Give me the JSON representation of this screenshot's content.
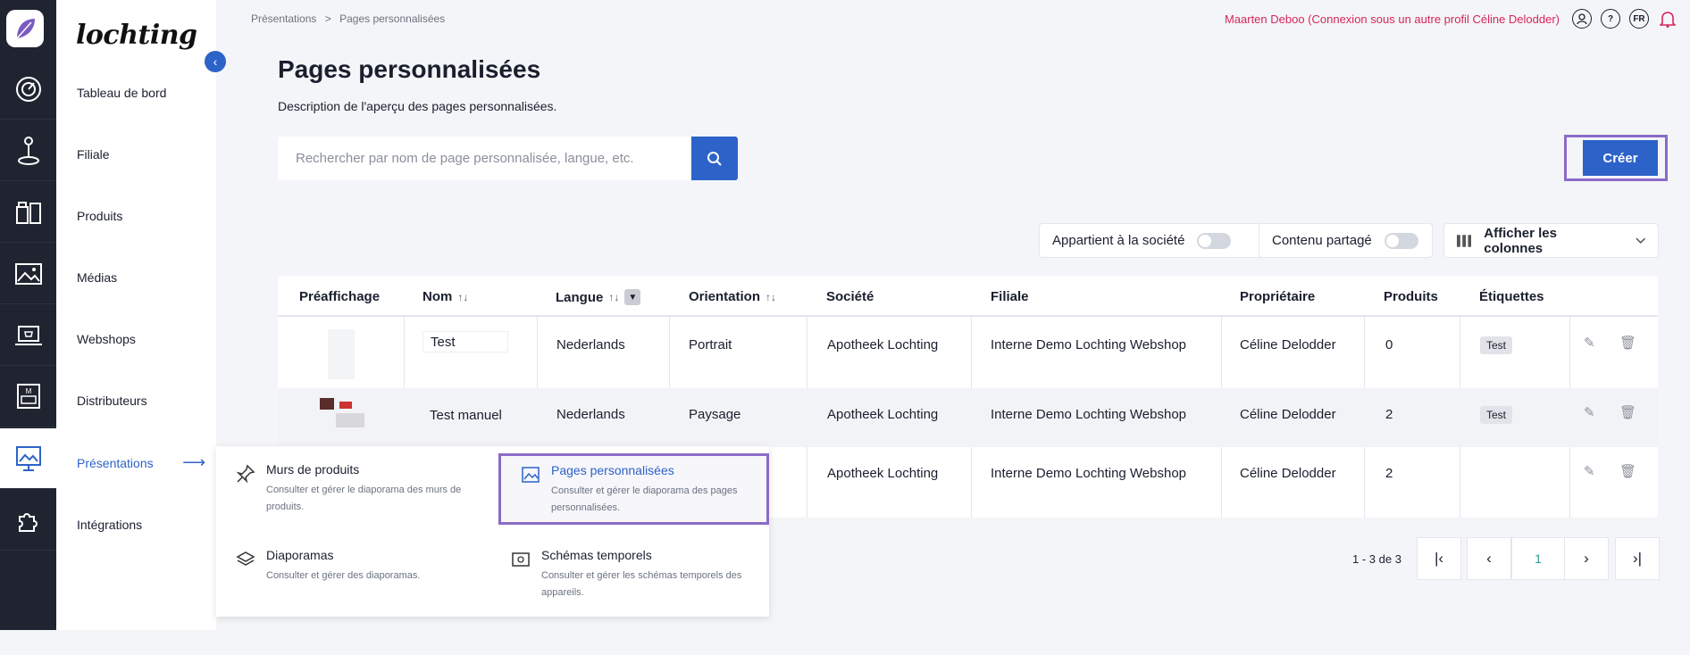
{
  "brand": "lochting",
  "breadcrumbs": [
    "Présentations",
    "Pages personnalisées"
  ],
  "breadcrumb_sep": ">",
  "user": {
    "label": "Maarten Deboo (Connexion sous un autre profil Céline Delodder)",
    "lang": "FR",
    "help": "?"
  },
  "sidebar": {
    "items": [
      {
        "label": "Tableau de bord"
      },
      {
        "label": "Filiale"
      },
      {
        "label": "Produits"
      },
      {
        "label": "Médias"
      },
      {
        "label": "Webshops"
      },
      {
        "label": "Distributeurs"
      },
      {
        "label": "Présentations"
      },
      {
        "label": "Intégrations"
      }
    ],
    "active_arrow": "⟶"
  },
  "page": {
    "title": "Pages personnalisées",
    "description": "Description de l'aperçu des pages personnalisées."
  },
  "search": {
    "placeholder": "Rechercher par nom de page personnalisée, langue, etc."
  },
  "create_label": "Créer",
  "filters": {
    "owned_label": "Appartient à la société",
    "shared_label": "Contenu partagé",
    "columns_label": "Afficher les colonnes"
  },
  "table": {
    "headers": [
      "Préaffichage",
      "Nom",
      "Langue",
      "Orientation",
      "Société",
      "Filiale",
      "Propriétaire",
      "Produits",
      "Étiquettes"
    ],
    "rows": [
      {
        "name": "Test",
        "language": "Nederlands",
        "orientation": "Portrait",
        "company": "Apotheek Lochting",
        "branch": "Interne Demo Lochting Webshop",
        "owner": "Céline Delodder",
        "products": "0",
        "tag": "Test"
      },
      {
        "name": "Test manuel",
        "language": "Nederlands",
        "orientation": "Paysage",
        "company": "Apotheek Lochting",
        "branch": "Interne Demo Lochting Webshop",
        "owner": "Céline Delodder",
        "products": "2",
        "tag": "Test"
      },
      {
        "company": "Apotheek Lochting",
        "branch": "Interne Demo Lochting Webshop",
        "owner": "Céline Delodder",
        "products": "2"
      }
    ]
  },
  "pagination": {
    "info": "1 - 3 de 3",
    "current": "1"
  },
  "menu": {
    "items": [
      {
        "title": "Murs de produits",
        "desc": "Consulter et gérer le diaporama des murs de produits."
      },
      {
        "title": "Pages personnalisées",
        "desc": "Consulter et gérer le diaporama des pages personnalisées."
      },
      {
        "title": "Diaporamas",
        "desc": "Consulter et gérer des diaporamas."
      },
      {
        "title": "Schémas temporels",
        "desc": "Consulter et gérer les schémas temporels des appareils."
      }
    ]
  },
  "colors": {
    "accent": "#2d63c8",
    "user": "#d6265a",
    "highlight": "#8a6bc7"
  }
}
